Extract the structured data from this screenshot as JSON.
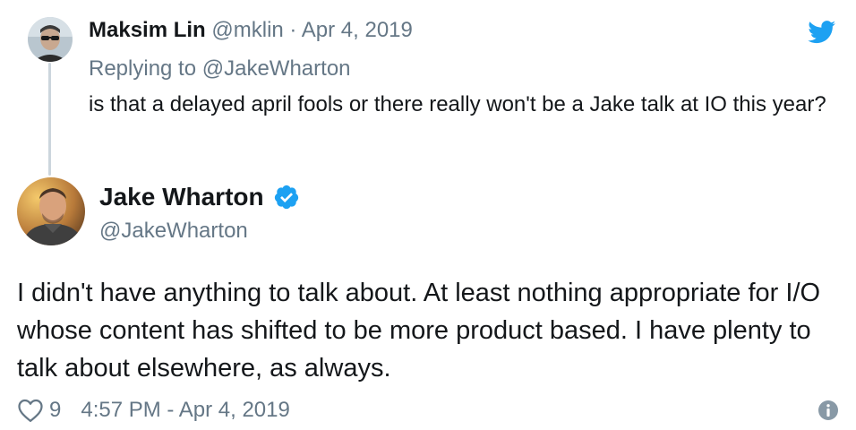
{
  "reply_tweet": {
    "author_name": "Maksim Lin",
    "author_handle": "@mklin",
    "separator": " · ",
    "date": "Apr 4, 2019",
    "replying_to_prefix": "Replying to ",
    "replying_to_handle": "@JakeWharton",
    "text": "is that a delayed april fools or there really won't be a Jake talk at IO this year?"
  },
  "main_tweet": {
    "author_name": "Jake Wharton",
    "author_handle": "@JakeWharton",
    "verified": true,
    "text": "I didn't have anything to talk about. At least nothing appropriate for I/O whose content has shifted to be more product based. I have plenty to talk about elsewhere, as always.",
    "like_count": "9",
    "timestamp": "4:57 PM - Apr 4, 2019"
  },
  "colors": {
    "twitter_blue": "#1da1f2",
    "muted_text": "#657786",
    "main_text": "#14171a",
    "thread_line": "#ccd6dd"
  },
  "icons": {
    "brand": "twitter-bird-icon",
    "verified": "verified-badge-icon",
    "like": "heart-icon",
    "info": "info-icon"
  }
}
